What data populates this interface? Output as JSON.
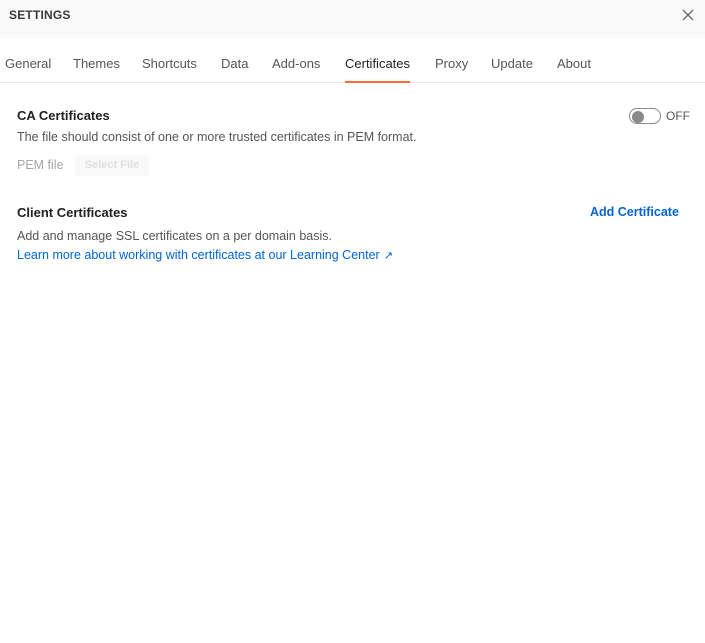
{
  "window": {
    "title": "SETTINGS"
  },
  "tabs": [
    {
      "label": "General",
      "active": false
    },
    {
      "label": "Themes",
      "active": false
    },
    {
      "label": "Shortcuts",
      "active": false
    },
    {
      "label": "Data",
      "active": false
    },
    {
      "label": "Add-ons",
      "active": false
    },
    {
      "label": "Certificates",
      "active": true
    },
    {
      "label": "Proxy",
      "active": false
    },
    {
      "label": "Update",
      "active": false
    },
    {
      "label": "About",
      "active": false
    }
  ],
  "ca_certificates": {
    "title": "CA Certificates",
    "description": "The file should consist of one or more trusted certificates in PEM format.",
    "pem_label": "PEM file",
    "select_file_label": "Select File",
    "toggle_label": "OFF",
    "toggle_on": false
  },
  "client_certificates": {
    "title": "Client Certificates",
    "add_label": "Add Certificate",
    "description": "Add and manage SSL certificates on a per domain basis.",
    "learn_more": "Learn more about working with certificates at our Learning Center",
    "learn_more_icon": "external-link-arrow-icon"
  },
  "colors": {
    "accent": "#ff6c37",
    "link": "#0265d2"
  }
}
